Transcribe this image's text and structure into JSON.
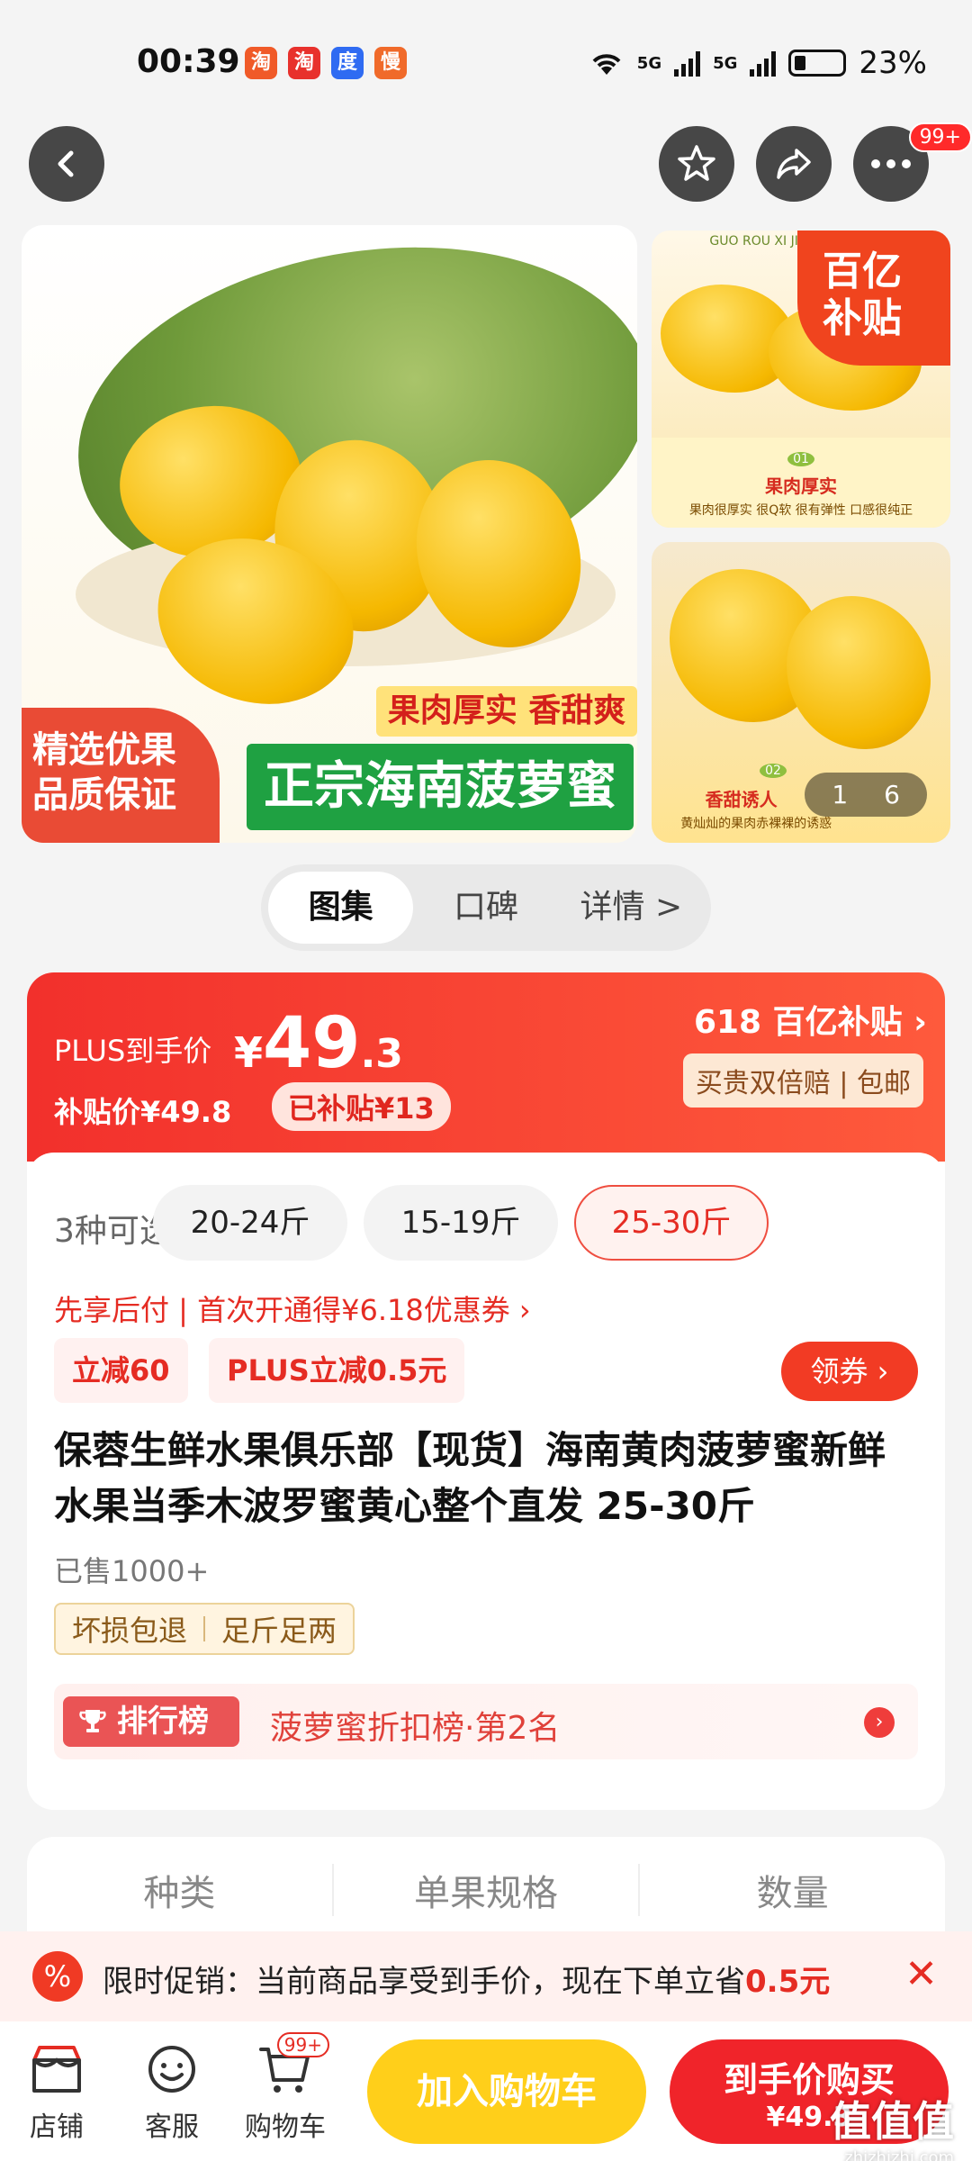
{
  "status_bar": {
    "time": "00:39",
    "network_1": "5G",
    "network_2": "5G",
    "battery": "23%",
    "app_icons": [
      "淘",
      "淘",
      "度",
      "慢"
    ]
  },
  "top_bar": {
    "notification_badge": "99+"
  },
  "gallery": {
    "main_overlay_left": "精选优果\n品质保证",
    "main_banner_yellow": "果肉厚实 香甜爽口",
    "main_banner_green": "正宗海南菠萝蜜",
    "side1_header": "GUO ROU XI JIE ZHAN SHI TU",
    "side1_number": "01",
    "side1_caption": "果肉厚实",
    "side1_sub": "果肉很厚实 很Q软 很有弹性 口感很纯正",
    "side2_number": "02",
    "side2_caption": "香甜诱人",
    "side2_sub": "黄灿灿的果肉赤裸裸的诱惑",
    "subsidy_tag": "百亿\n补贴",
    "counter_current": "1",
    "counter_total": "6"
  },
  "tabs": [
    {
      "label": "图集"
    },
    {
      "label": "口碑"
    },
    {
      "label": "详情 >"
    }
  ],
  "price": {
    "plus_label": "PLUS到手价",
    "currency": "¥",
    "integer": "49",
    "decimal": ".3",
    "subsidy_price": "补贴价¥49.8",
    "subsidy_pill": "已补贴¥13",
    "campaign": "618 百亿补贴 ›",
    "guarantee": "买贵双倍赔 | 包邮"
  },
  "options": {
    "count_label": "3种可选",
    "sizes": [
      "20-24斤",
      "15-19斤",
      "25-30斤"
    ],
    "pay_later": "先享后付 | 首次开通得¥6.18优惠券 ›",
    "deal_1": "立减60",
    "deal_2": "PLUS立减0.5元",
    "coupon_button": "领券 ›",
    "title": "保蓉生鲜水果俱乐部【现货】海南黄肉菠萝蜜新鲜水果当季木波罗蜜黄心整个直发 25-30斤",
    "sold": "已售1000+",
    "tag_1": "坏损包退",
    "tag_2": "足斤足两",
    "rank_tag": "排行榜",
    "rank_text": "菠萝蜜折扣榜·第2名"
  },
  "spec": {
    "columns": [
      "种类",
      "单果规格",
      "数量"
    ]
  },
  "promo": {
    "icon": "%",
    "text_prefix": "限时促销：当前商品享受到手价，现在下单立省",
    "amount": "0.5元",
    "close": "✕"
  },
  "bottom_bar": {
    "shop": "店铺",
    "service": "客服",
    "cart": "购物车",
    "cart_badge": "99+",
    "add_to_cart": "加入购物车",
    "buy_line1": "到手价购买",
    "buy_line2": "¥49.3",
    "watermark": "值值值",
    "watermark_url": "zhizhizhi.com"
  },
  "colors": {
    "accent_red": "#f0242a",
    "cart_yellow": "#ffcf1a",
    "rank_red": "#ea5455"
  }
}
